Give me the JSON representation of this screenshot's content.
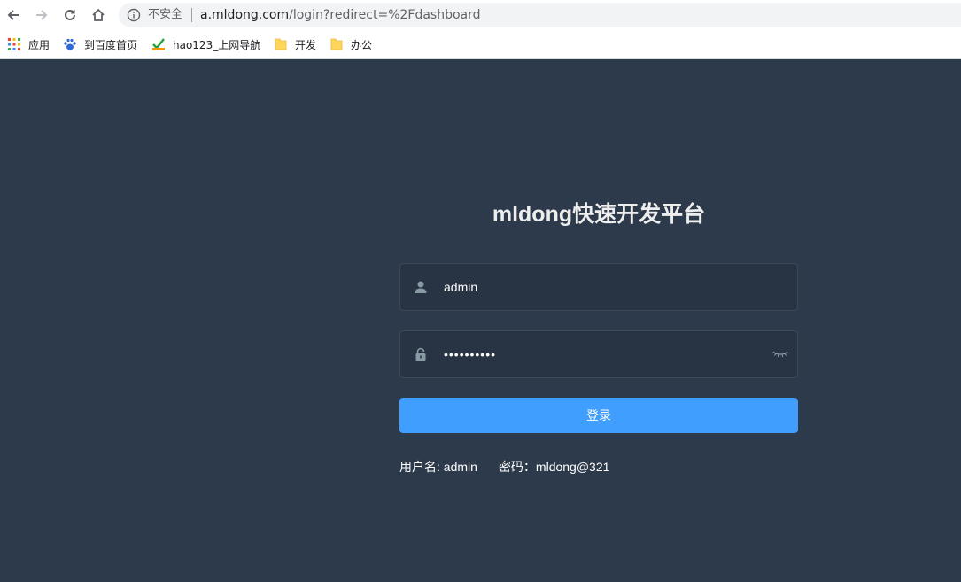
{
  "browser": {
    "insecure_label": "不安全",
    "url_host": "a.mldong.com",
    "url_path": "/login?redirect=%2Fdashboard"
  },
  "bookmarks": [
    {
      "label": "应用",
      "icon": "apps-grid-icon"
    },
    {
      "label": "到百度首页",
      "icon": "baidu-paw-icon"
    },
    {
      "label": "hao123_上网导航",
      "icon": "hao123-icon"
    },
    {
      "label": "开发",
      "icon": "folder-icon"
    },
    {
      "label": "办公",
      "icon": "folder-icon"
    }
  ],
  "login": {
    "title": "mldong快速开发平台",
    "username_value": "admin",
    "password_masked": "••••••••••",
    "submit_label": "登录",
    "tip_username": "用户名: admin",
    "tip_password": "密码：mldong@321"
  },
  "colors": {
    "page_bg": "#2d3a4b",
    "input_bg": "#283443",
    "button_bg": "#409eff",
    "title_color": "#eeeeee"
  }
}
